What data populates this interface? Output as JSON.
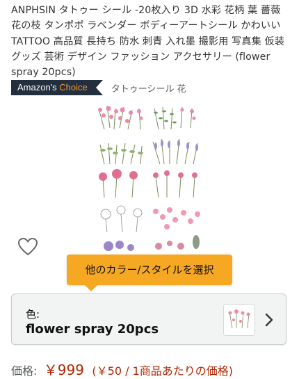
{
  "product": {
    "title": "ANPHSIN タトゥー シール -20枚入り 3D 水彩 花柄 葉 薔薇 花の枝 タンポポ ラベンダー ボディーアートシール かわいい TATTOO 高品質 長持ち 防水 刺青 入れ墨 撮影用 写真集 仮装グッズ 芸術 デザイン ファッション アクセサリー (flower spray 20pcs)"
  },
  "badge": {
    "prefix": "Amazon's",
    "accent": "Choice",
    "category": "タトゥーシール 花",
    "bg_color": "#232f3e",
    "accent_color": "#f69931"
  },
  "image": {
    "alt": "flower tattoo sticker sheet",
    "wishlist_icon": "heart-outline-icon"
  },
  "tooltip": {
    "text": "他のカラー/スタイルを選択",
    "color": "#f7a823"
  },
  "variant": {
    "label": "色:",
    "value": "flower spray 20pcs",
    "chevron_icon": "chevron-right-icon"
  },
  "price": {
    "label": "価格:",
    "value": "￥999",
    "unit_price": "(￥50 / 1商品あたりの価格)",
    "color": "#b12704"
  }
}
